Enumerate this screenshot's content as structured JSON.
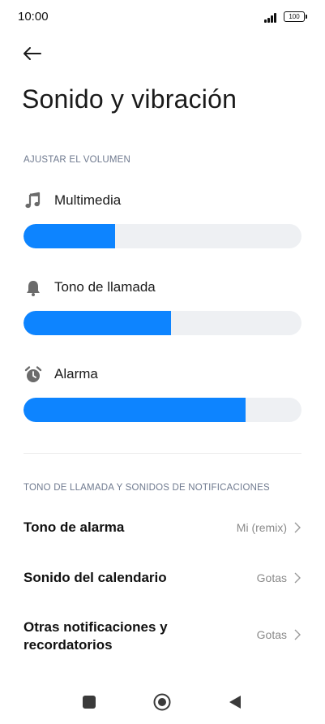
{
  "status_bar": {
    "time": "10:00",
    "battery": "100"
  },
  "header": {
    "title": "Sonido y vibración"
  },
  "volume_section": {
    "heading": "AJUSTAR EL VOLUMEN",
    "items": [
      {
        "label": "Multimedia",
        "icon": "music-note-icon",
        "level_percent": 33
      },
      {
        "label": "Tono de llamada",
        "icon": "bell-icon",
        "level_percent": 53
      },
      {
        "label": "Alarma",
        "icon": "alarm-clock-icon",
        "level_percent": 80
      }
    ]
  },
  "ringtone_section": {
    "heading": "TONO DE LLAMADA Y SONIDOS DE NOTIFICACIONES",
    "items": [
      {
        "label": "Tono de alarma",
        "value": "Mi (remix)"
      },
      {
        "label": "Sonido del calendario",
        "value": "Gotas"
      },
      {
        "label_line1": "Otras notificaciones y",
        "label_line2": "recordatorios",
        "value": "Gotas"
      }
    ]
  },
  "colors": {
    "accent": "#0d84ff",
    "track": "#eef0f3",
    "section_header": "#6f7a8f"
  }
}
